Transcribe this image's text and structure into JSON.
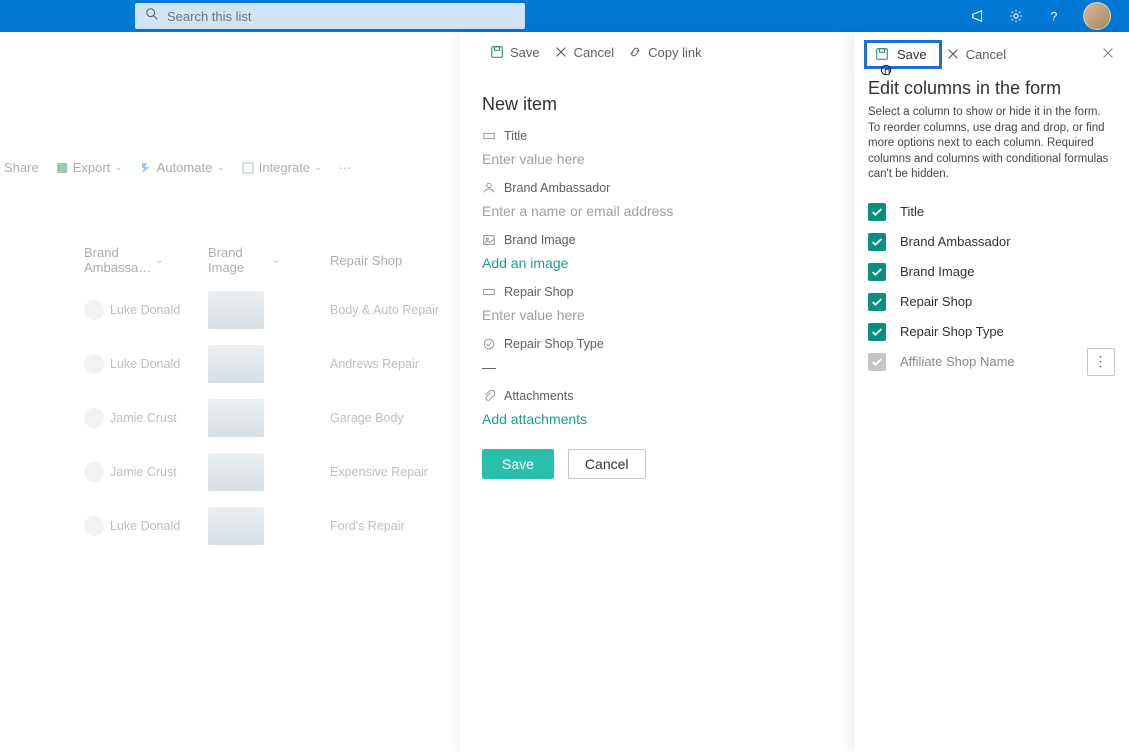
{
  "colors": {
    "brand": "#0078d4",
    "accent": "#0a8f7e"
  },
  "topbar": {
    "search_placeholder": "Search this list"
  },
  "list": {
    "toolbar": {
      "share": "Share",
      "export": "Export",
      "automate": "Automate",
      "integrate": "Integrate"
    },
    "columns": [
      "Brand Ambassa…",
      "Brand Image",
      "Repair Shop"
    ],
    "rows": [
      {
        "ambassador": "Luke Donald",
        "repair_shop": "Body & Auto Repair"
      },
      {
        "ambassador": "Luke Donald",
        "repair_shop": "Andrews Repair"
      },
      {
        "ambassador": "Jamie Crust",
        "repair_shop": "Garage Body"
      },
      {
        "ambassador": "Jamie Crust",
        "repair_shop": "Expensive Repair"
      },
      {
        "ambassador": "Luke Donald",
        "repair_shop": "Ford's Repair"
      }
    ]
  },
  "newitem": {
    "cmd": {
      "save": "Save",
      "cancel": "Cancel",
      "copylink": "Copy link"
    },
    "title": "New item",
    "fields": {
      "title_label": "Title",
      "title_placeholder": "Enter value here",
      "ambassador_label": "Brand Ambassador",
      "ambassador_placeholder": "Enter a name or email address",
      "image_label": "Brand Image",
      "image_action": "Add an image",
      "shop_label": "Repair Shop",
      "shop_placeholder": "Enter value here",
      "shoptype_label": "Repair Shop Type",
      "shoptype_value": "—",
      "attach_label": "Attachments",
      "attach_action": "Add attachments"
    },
    "buttons": {
      "save": "Save",
      "cancel": "Cancel"
    }
  },
  "editcols": {
    "cmd": {
      "save": "Save",
      "cancel": "Cancel"
    },
    "title": "Edit columns in the form",
    "description": "Select a column to show or hide it in the form. To reorder columns, use drag and drop, or find more options next to each column. Required columns and columns with conditional formulas can't be hidden.",
    "columns": [
      {
        "label": "Title",
        "checked": true,
        "locked": false
      },
      {
        "label": "Brand Ambassador",
        "checked": true,
        "locked": false
      },
      {
        "label": "Brand Image",
        "checked": true,
        "locked": false
      },
      {
        "label": "Repair Shop",
        "checked": true,
        "locked": false
      },
      {
        "label": "Repair Shop Type",
        "checked": true,
        "locked": false
      },
      {
        "label": "Affiliate Shop Name",
        "checked": true,
        "locked": true
      }
    ]
  }
}
